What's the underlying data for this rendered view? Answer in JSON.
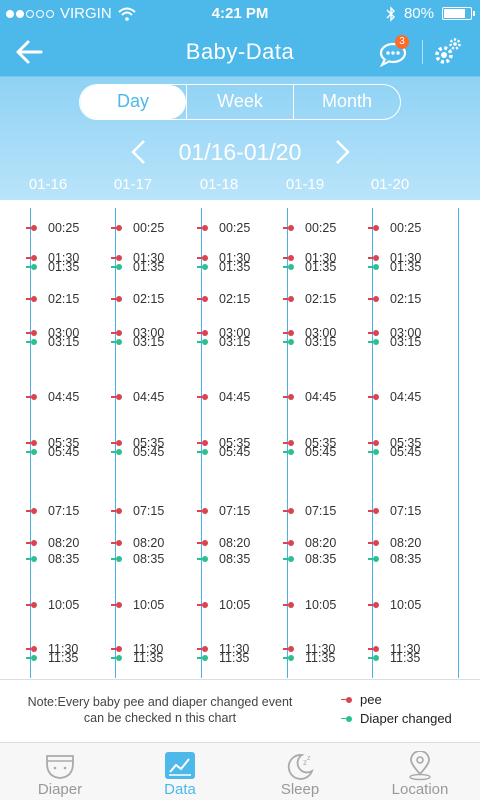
{
  "status": {
    "carrier": "VIRGIN",
    "time": "4:21 PM",
    "battery": "80%",
    "battery_level": 0.8
  },
  "header": {
    "title": "Baby-Data",
    "badge_count": "3"
  },
  "segments": [
    {
      "label": "Day",
      "active": true
    },
    {
      "label": "Week",
      "active": false
    },
    {
      "label": "Month",
      "active": false
    }
  ],
  "range": {
    "label": "01/16-01/20"
  },
  "dates": [
    "01-16",
    "01-17",
    "01-18",
    "01-19",
    "01-20"
  ],
  "events": [
    {
      "time": "00:25",
      "type": "pee"
    },
    {
      "time": "01:30",
      "type": "pee"
    },
    {
      "time": "01:35",
      "type": "diaper"
    },
    {
      "time": "02:15",
      "type": "pee"
    },
    {
      "time": "03:00",
      "type": "pee"
    },
    {
      "time": "03:15",
      "type": "diaper"
    },
    {
      "time": "04:45",
      "type": "pee"
    },
    {
      "time": "05:35",
      "type": "pee"
    },
    {
      "time": "05:45",
      "type": "diaper"
    },
    {
      "time": "07:15",
      "type": "pee"
    },
    {
      "time": "08:20",
      "type": "pee"
    },
    {
      "time": "08:35",
      "type": "diaper"
    },
    {
      "time": "10:05",
      "type": "pee"
    },
    {
      "time": "11:30",
      "type": "pee"
    },
    {
      "time": "11:35",
      "type": "diaper"
    }
  ],
  "note": "Note:Every baby pee and diaper changed event can be checked n this chart",
  "legend": {
    "pee": "pee",
    "diaper": "Diaper changed"
  },
  "colors": {
    "primary": "#4db8ea",
    "pee": "#d94450",
    "diaper": "#2bbf92",
    "badge": "#ff6b2a"
  },
  "tabs": [
    {
      "label": "Diaper",
      "icon": "diaper-icon",
      "active": false
    },
    {
      "label": "Data",
      "icon": "chart-icon",
      "active": true
    },
    {
      "label": "Sleep",
      "icon": "moon-sleep-icon",
      "active": false
    },
    {
      "label": "Location",
      "icon": "location-pin-icon",
      "active": false
    }
  ]
}
